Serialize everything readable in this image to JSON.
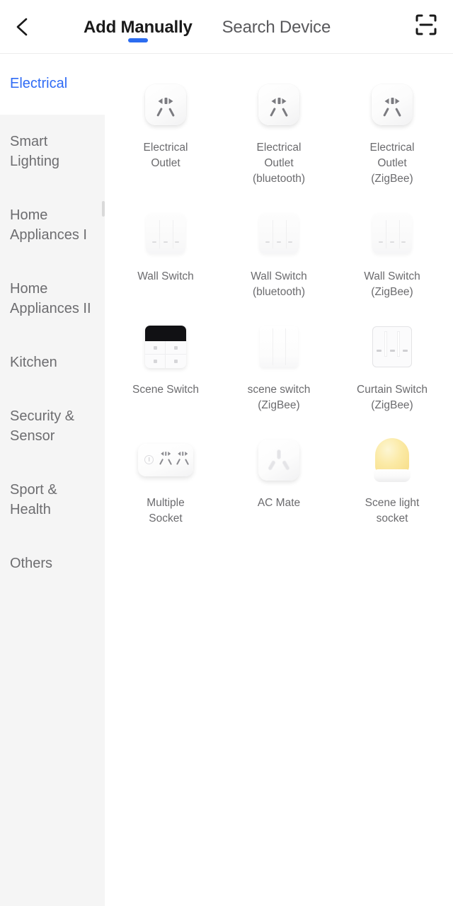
{
  "header": {
    "back_icon": "chevron-left-icon",
    "scan_icon": "scan-qr-icon",
    "tabs": [
      {
        "label": "Add Manually",
        "active": true
      },
      {
        "label": "Search Device",
        "active": false
      }
    ],
    "accent_color": "#2b6cf0"
  },
  "sidebar": {
    "active_color": "#2f6bf5",
    "panel_color": "#f5f5f5",
    "items": [
      {
        "label": "Electrical",
        "active": true
      },
      {
        "label": "Smart Lighting",
        "active": false
      },
      {
        "label": "Home Appliances I",
        "active": false
      },
      {
        "label": "Home Appliances II",
        "active": false
      },
      {
        "label": "Kitchen",
        "active": false
      },
      {
        "label": "Security & Sensor",
        "active": false
      },
      {
        "label": "Sport & Health",
        "active": false
      },
      {
        "label": "Others",
        "active": false
      }
    ]
  },
  "devices": [
    {
      "label": "Electrical\nOutlet",
      "icon": "electrical-outlet-icon"
    },
    {
      "label": "Electrical\nOutlet\n(bluetooth)",
      "icon": "electrical-outlet-bluetooth-icon"
    },
    {
      "label": "Electrical\nOutlet\n(ZigBee)",
      "icon": "electrical-outlet-zigbee-icon"
    },
    {
      "label": "Wall Switch",
      "icon": "wall-switch-icon"
    },
    {
      "label": "Wall Switch\n(bluetooth)",
      "icon": "wall-switch-bluetooth-icon"
    },
    {
      "label": "Wall Switch\n(ZigBee)",
      "icon": "wall-switch-zigbee-icon"
    },
    {
      "label": "Scene Switch",
      "icon": "scene-switch-icon"
    },
    {
      "label": "scene switch\n(ZigBee)",
      "icon": "scene-switch-zigbee-icon"
    },
    {
      "label": "Curtain Switch\n(ZigBee)",
      "icon": "curtain-switch-zigbee-icon"
    },
    {
      "label": "Multiple\nSocket",
      "icon": "multiple-socket-icon"
    },
    {
      "label": "AC Mate",
      "icon": "ac-mate-icon"
    },
    {
      "label": "Scene light\nsocket",
      "icon": "scene-light-socket-icon"
    }
  ]
}
